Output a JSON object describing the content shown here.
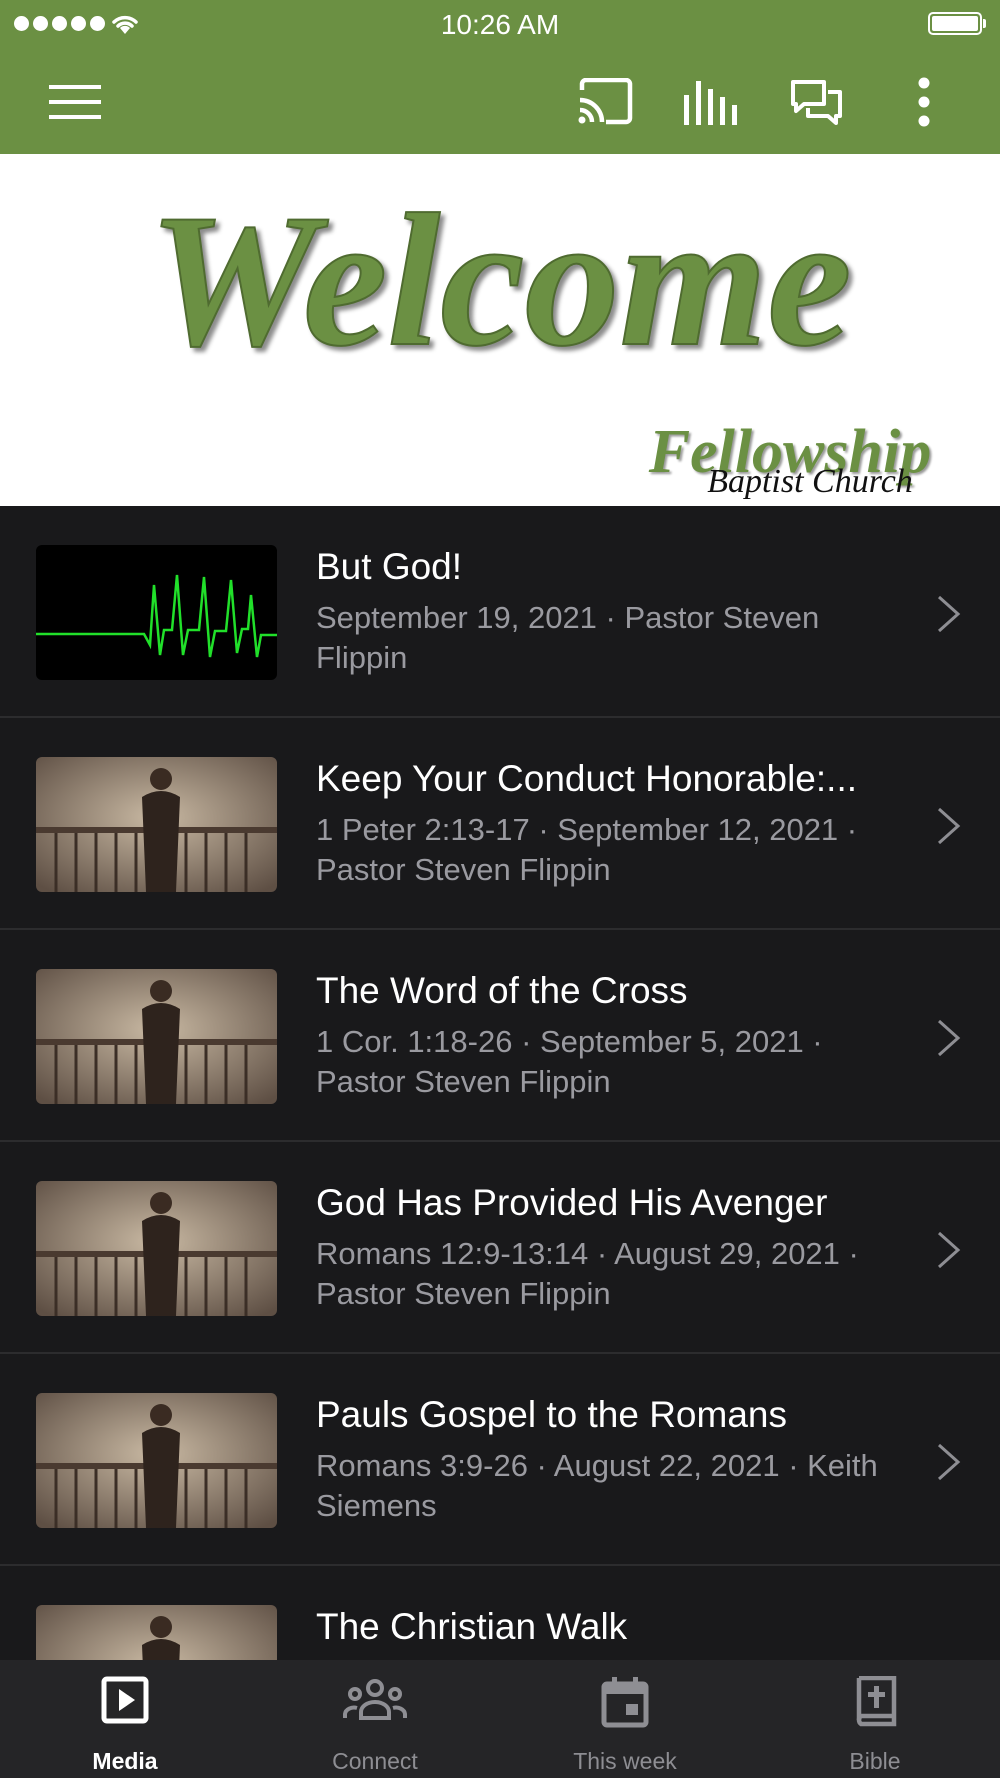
{
  "status_bar": {
    "time": "10:26 AM"
  },
  "app_bar": {
    "icons": [
      "menu-icon",
      "cast-icon",
      "equalizer-icon",
      "chat-icon",
      "more-vert-icon"
    ],
    "color": "#6b9043"
  },
  "banner": {
    "welcome_text": "Welcome",
    "church_name_line1": "Fellowship",
    "church_name_line2": "Baptist Church"
  },
  "media": {
    "items": [
      {
        "title": "But God!",
        "subtitle": "September 19, 2021 · Pastor Steven Flippin",
        "thumbnail": "heartbeat"
      },
      {
        "title": "Keep Your Conduct Honorable:...",
        "subtitle": "1 Peter 2:13-17 · September 12, 2021 · Pastor Steven Flippin",
        "thumbnail": "preacher"
      },
      {
        "title": "The Word of the Cross",
        "subtitle": "1 Cor. 1:18-26 · September 5, 2021 · Pastor Steven Flippin",
        "thumbnail": "preacher"
      },
      {
        "title": "God Has Provided His Avenger",
        "subtitle": "Romans 12:9-13:14 · August 29, 2021 · Pastor Steven Flippin",
        "thumbnail": "preacher"
      },
      {
        "title": "Pauls Gospel to the Romans",
        "subtitle": "Romans 3:9-26 · August 22, 2021 · Keith Siemens",
        "thumbnail": "preacher"
      },
      {
        "title": "The Christian Walk",
        "subtitle": "",
        "thumbnail": "preacher"
      }
    ]
  },
  "tab_bar": {
    "tabs": [
      {
        "label": "Media",
        "icon": "play-box-icon",
        "active": true
      },
      {
        "label": "Connect",
        "icon": "group-icon",
        "active": false
      },
      {
        "label": "This week",
        "icon": "calendar-icon",
        "active": false
      },
      {
        "label": "Bible",
        "icon": "bible-icon",
        "active": false
      }
    ]
  }
}
